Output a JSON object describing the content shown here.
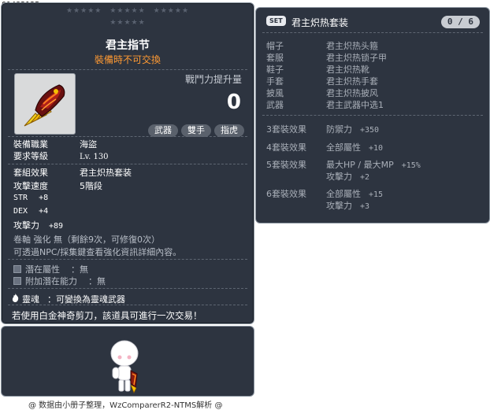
{
  "item_id": "01482135",
  "item": {
    "stars_row1": [
      "★★★★★",
      "★★★★★",
      "★★★★★"
    ],
    "stars_row2": [
      "★★★★★"
    ],
    "name": "君主指节",
    "subtitle": "裝備時不可交換",
    "icon": "knuckle-weapon-icon",
    "power_label": "戰鬥力提升量",
    "power_value": "0",
    "tags": [
      "武器",
      "雙手",
      "指虎"
    ],
    "job_label": "裝備職業",
    "job_value": "海盜",
    "level_label": "要求等級",
    "level_value": "Lv. 130",
    "set_label": "套組效果",
    "set_value": "君主炽热套装",
    "speed_label": "攻擊速度",
    "speed_value": "5階段",
    "str_label": "STR",
    "str_value": "+8",
    "dex_label": "DEX",
    "dex_value": "+4",
    "atk_label": "攻擊力",
    "atk_value": "+89",
    "scroll_note": "卷軸 強化 無（剩餘9次，可修復0次）",
    "enhance_note": "可透過NPC/採集鍵查看強化資訊詳細內容。",
    "potential_label": "潛在屬性",
    "potential_value": "：無",
    "bonus_potential_label": "附加潛在能力",
    "bonus_potential_value": "：無",
    "soul_label": "靈魂",
    "soul_value": "：可變換為靈魂武器",
    "trade_note": "若使用白金神奇剪刀，該道具可進行一次交易！"
  },
  "credit": "@ 数据由小册子整理，WzComparerR2-NTMS解析 @",
  "set": {
    "badge": "SET",
    "title": "君主炽热套装",
    "count": "0 / 6",
    "pieces": [
      {
        "slot": "帽子",
        "name": "君主炽热头箍"
      },
      {
        "slot": "套服",
        "name": "君主炽热锁子甲"
      },
      {
        "slot": "鞋子",
        "name": "君主炽热靴"
      },
      {
        "slot": "手套",
        "name": "君主炽热手套"
      },
      {
        "slot": "披風",
        "name": "君主炽热披风"
      },
      {
        "slot": "武器",
        "name": "君主武器中选1"
      }
    ],
    "effects": [
      {
        "label": "3套裝效果",
        "lines": [
          {
            "stat": "防禦力",
            "val": "+350"
          }
        ]
      },
      {
        "label": "4套裝效果",
        "lines": [
          {
            "stat": "全部屬性",
            "val": "+10"
          }
        ]
      },
      {
        "label": "5套裝效果",
        "lines": [
          {
            "stat": "最大HP / 最大MP",
            "val": "+15%"
          },
          {
            "stat": "攻擊力",
            "val": "+2"
          }
        ]
      },
      {
        "label": "6套裝效果",
        "lines": [
          {
            "stat": "全部屬性",
            "val": "+15"
          },
          {
            "stat": "攻擊力",
            "val": "+3"
          }
        ]
      }
    ]
  }
}
